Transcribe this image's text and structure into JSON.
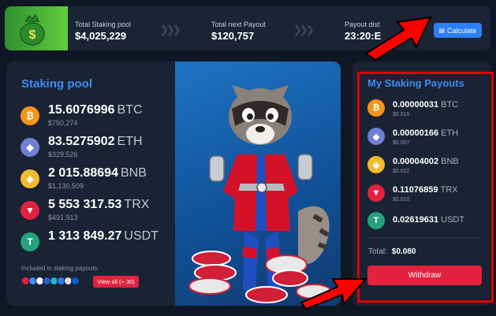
{
  "top_stats": [
    {
      "label": "Total Staking pool",
      "value": "$4,025,229"
    },
    {
      "label": "Total next Payout",
      "value": "$120,757"
    },
    {
      "label": "Payout dist",
      "value": "23:20:E"
    }
  ],
  "calculate_label": "Calculate",
  "staking_pool": {
    "title": "Staking pool",
    "assets": [
      {
        "amount": "15.6076996",
        "symbol": "BTC",
        "usd": "$750,274",
        "color": "#f7931a",
        "icon": "bitcoin-icon"
      },
      {
        "amount": "83.5275902",
        "symbol": "ETH",
        "usd": "$329,526",
        "color": "#6f7fd6",
        "icon": "ethereum-icon"
      },
      {
        "amount": "2 015.88694",
        "symbol": "BNB",
        "usd": "$1,130,509",
        "color": "#f3ba2f",
        "icon": "bnb-icon"
      },
      {
        "amount": "5 553 317.53",
        "symbol": "TRX",
        "usd": "$491,913",
        "color": "#e3213f",
        "icon": "tron-icon"
      },
      {
        "amount": "1 313 849.27",
        "symbol": "USDT",
        "usd": "",
        "color": "#26a17b",
        "icon": "tether-icon"
      }
    ],
    "included_label": "Included in staking payouts:",
    "view_all_label": "View all (+ 30)"
  },
  "payouts": {
    "title": "My Staking Payouts",
    "items": [
      {
        "amount": "0.00000031",
        "symbol": "BTC",
        "usd": "$0.015",
        "color": "#f7931a"
      },
      {
        "amount": "0.00000166",
        "symbol": "ETH",
        "usd": "$0.007",
        "color": "#6f7fd6"
      },
      {
        "amount": "0.00004002",
        "symbol": "BNB",
        "usd": "$0.022",
        "color": "#f3ba2f"
      },
      {
        "amount": "0.11076859",
        "symbol": "TRX",
        "usd": "$0.010",
        "color": "#e3213f"
      },
      {
        "amount": "0.02619631",
        "symbol": "USDT",
        "usd": "",
        "color": "#26a17b"
      }
    ],
    "total_label": "Total:",
    "total_value": "$0.080",
    "withdraw_label": "Withdraw"
  },
  "colors": {
    "accent": "#3d8cf5",
    "danger": "#e3213f",
    "bg": "#0f1724",
    "card": "#1a2333"
  }
}
